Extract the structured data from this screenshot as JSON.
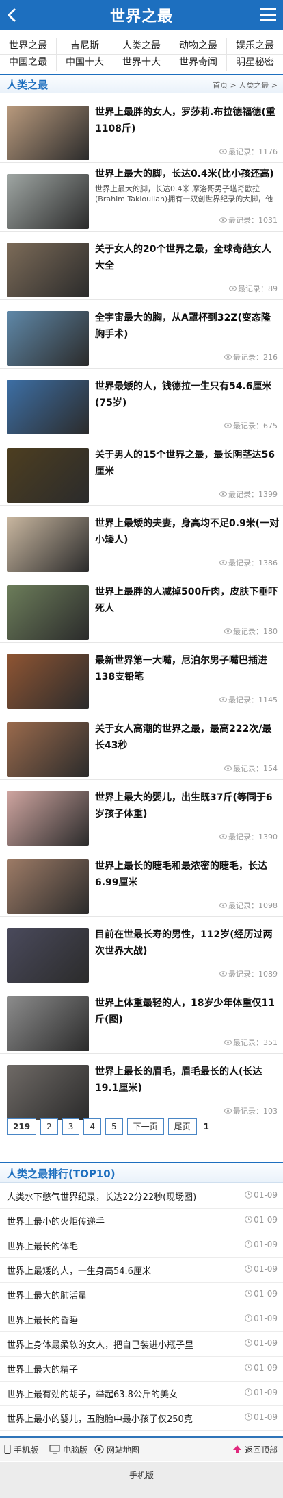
{
  "header": {
    "logo_text": "世界之最",
    "back_icon": "chevron-left-icon",
    "menu_icon": "hamburger-menu-icon"
  },
  "nav": {
    "row1": [
      "世界之最",
      "吉尼斯",
      "人类之最",
      "动物之最",
      "娱乐之最"
    ],
    "row2": [
      "中国之最",
      "中国十大",
      "世界十大",
      "世界奇闻",
      "明星秘密"
    ]
  },
  "section": {
    "title": "人类之最",
    "breadcrumb": "首页 > 人类之最 >"
  },
  "articles": [
    {
      "title": "世界上最胖的女人，罗莎莉.布拉德福德(重1108斤)",
      "desc": "",
      "meta": "最记录：1176",
      "bg": "#b99a7d"
    },
    {
      "title": "世界上最大的脚，长达0.4米(比小孩还高)",
      "desc": "世界上最大的脚，长达0.4米 摩洛哥男子塔奇欧拉(Brahim Takioullah)拥有一双创世界纪录的大脚，他",
      "meta": "最记录：1031",
      "bg": "#9fa6a3"
    },
    {
      "title": "关于女人的20个世界之最，全球奇葩女人大全",
      "desc": "",
      "meta": "最记录：89",
      "bg": "#7c6b58"
    },
    {
      "title": "全宇宙最大的胸，从A罩杯到32Z(变态隆胸手术)",
      "desc": "",
      "meta": "最记录：216",
      "bg": "#5f88a8"
    },
    {
      "title": "世界最矮的人，钱德拉一生只有54.6厘米(75岁)",
      "desc": "",
      "meta": "最记录：675",
      "bg": "#3d6fa5"
    },
    {
      "title": "关于男人的15个世界之最，最长阴茎达56厘米",
      "desc": "",
      "meta": "最记录：1399",
      "bg": "#4d3e20"
    },
    {
      "title": "世界上最矮的夫妻，身高均不足0.9米(一对小矮人)",
      "desc": "",
      "meta": "最记录：1386",
      "bg": "#c9b7a0"
    },
    {
      "title": "世界上最胖的人减掉500斤肉，皮肤下垂吓死人",
      "desc": "",
      "meta": "最记录：180",
      "bg": "#6c7d5a"
    },
    {
      "title": "最新世界第一大嘴，尼泊尔男子嘴巴插进138支铅笔",
      "desc": "",
      "meta": "最记录：1145",
      "bg": "#8f5533"
    },
    {
      "title": "关于女人高潮的世界之最，最高222次/最长43秒",
      "desc": "",
      "meta": "最记录：154",
      "bg": "#9a6a4c"
    },
    {
      "title": "世界上最大的婴儿，出生既37斤(等同于6岁孩子体重)",
      "desc": "",
      "meta": "最记录：1390",
      "bg": "#cfa5a0"
    },
    {
      "title": "世界上最长的睫毛和最浓密的睫毛，长达6.99厘米",
      "desc": "",
      "meta": "最记录：1098",
      "bg": "#9d7b66"
    },
    {
      "title": "目前在世最长寿的男性，112岁(经历过两次世界大战)",
      "desc": "",
      "meta": "最记录：1089",
      "bg": "#4a4a5c"
    },
    {
      "title": "世界上体重最轻的人，18岁少年体重仅11斤(图)",
      "desc": "",
      "meta": "最记录：351",
      "bg": "#8c8c8c"
    },
    {
      "title": "世界上最长的眉毛，眉毛最长的人(长达19.1厘米)",
      "desc": "",
      "meta": "最记录：103",
      "bg": "#6f6a66"
    }
  ],
  "pager": {
    "items": [
      "219",
      "2",
      "3",
      "4",
      "5",
      "下一页",
      "尾页"
    ],
    "current_page": "1"
  },
  "ranking": {
    "title": "人类之最排行(TOP10)",
    "items": [
      {
        "title": "人类水下憋气世界纪录，长达22分22秒(现场图)",
        "date": "01-09"
      },
      {
        "title": "世界上最小的火炬传递手",
        "date": "01-09"
      },
      {
        "title": "世界上最长的体毛",
        "date": "01-09"
      },
      {
        "title": "世界上最矮的人，一生身高54.6厘米",
        "date": "01-09"
      },
      {
        "title": "世界上最大的肺活量",
        "date": "01-09"
      },
      {
        "title": "世界上最长的昏睡",
        "date": "01-09"
      },
      {
        "title": "世界上身体最柔软的女人，把自己装进小瓶子里",
        "date": "01-09"
      },
      {
        "title": "世界上最大的精子",
        "date": "01-09"
      },
      {
        "title": "世界上最有劲的胡子，举起63.8公斤的美女",
        "date": "01-09"
      },
      {
        "title": "世界上最小的婴儿，五胞胎中最小孩子仅250克",
        "date": "01-09"
      }
    ]
  },
  "footer": {
    "mobile": "手机版",
    "pc": "电脑版",
    "sitemap": "网站地图",
    "top": "返回顶部",
    "bottom_text": "手机版"
  },
  "colors": {
    "accent": "#1d6fbf",
    "clock": "#aaaaaa"
  }
}
